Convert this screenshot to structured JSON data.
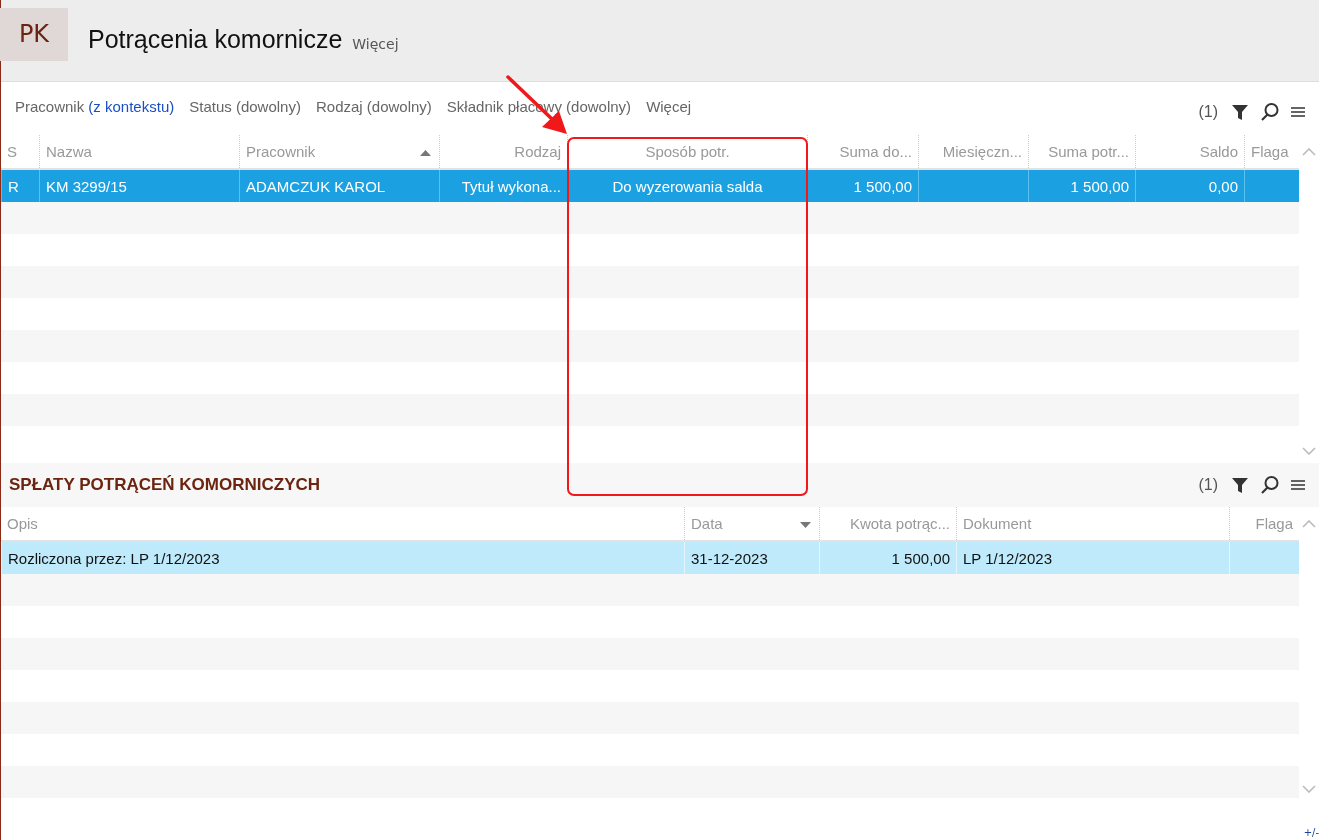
{
  "header": {
    "badge": "PK",
    "title": "Potrącenia komornicze",
    "more": "Więcej"
  },
  "filters": [
    {
      "label": "Pracownik",
      "value": "(z kontekstu)",
      "active": true
    },
    {
      "label": "Status",
      "value": "(dowolny)",
      "active": false
    },
    {
      "label": "Rodzaj",
      "value": "(dowolny)",
      "active": false
    },
    {
      "label": "Składnik płacowy",
      "value": "(dowolny)",
      "active": false
    }
  ],
  "filters_more": "Więcej",
  "toolbar": {
    "count": "(1)"
  },
  "main_table": {
    "focused": true,
    "columns": [
      {
        "label": "S",
        "kind": "text",
        "sorted": false
      },
      {
        "label": "Nazwa",
        "kind": "text",
        "sorted": false
      },
      {
        "label": "Pracownik",
        "kind": "text",
        "sorted": true,
        "descending": false
      },
      {
        "label": "Rodzaj",
        "kind": "amount",
        "sorted": false
      },
      {
        "label": "Sposób potr.",
        "kind": "centered",
        "sorted": false
      },
      {
        "label": "Suma do...",
        "kind": "amount",
        "sorted": false
      },
      {
        "label": "Miesięczn...",
        "kind": "amount",
        "sorted": false
      },
      {
        "label": "Suma potr...",
        "kind": "amount",
        "sorted": false
      },
      {
        "label": "Saldo",
        "kind": "amount",
        "sorted": false
      },
      {
        "label": "Flaga",
        "kind": "text",
        "sorted": false
      }
    ],
    "rows": [
      {
        "selected": true,
        "cells": [
          "R",
          "KM 3299/15",
          "ADAMCZUK KAROL",
          "Tytuł wykona...",
          "Do wyzerowania salda",
          "1 500,00",
          "",
          "1 500,00",
          "0,00",
          ""
        ]
      }
    ]
  },
  "section": {
    "title": "SPŁATY POTRĄCEŃ KOMORNICZYCH",
    "count": "(1)"
  },
  "payments_table": {
    "focused": false,
    "columns": [
      {
        "label": "Opis",
        "kind": "text",
        "sorted": false
      },
      {
        "label": "Data",
        "kind": "text",
        "sorted": true,
        "descending": true
      },
      {
        "label": "Kwota potrąc...",
        "kind": "amount",
        "sorted": false
      },
      {
        "label": "Dokument",
        "kind": "text",
        "sorted": false
      },
      {
        "label": "Flaga",
        "kind": "amount",
        "sorted": false
      }
    ],
    "rows": [
      {
        "selected": true,
        "cells": [
          "Rozliczona przez: LP 1/12/2023",
          "31-12-2023",
          "1 500,00",
          "LP 1/12/2023",
          ""
        ]
      }
    ]
  },
  "corner": "+/-"
}
